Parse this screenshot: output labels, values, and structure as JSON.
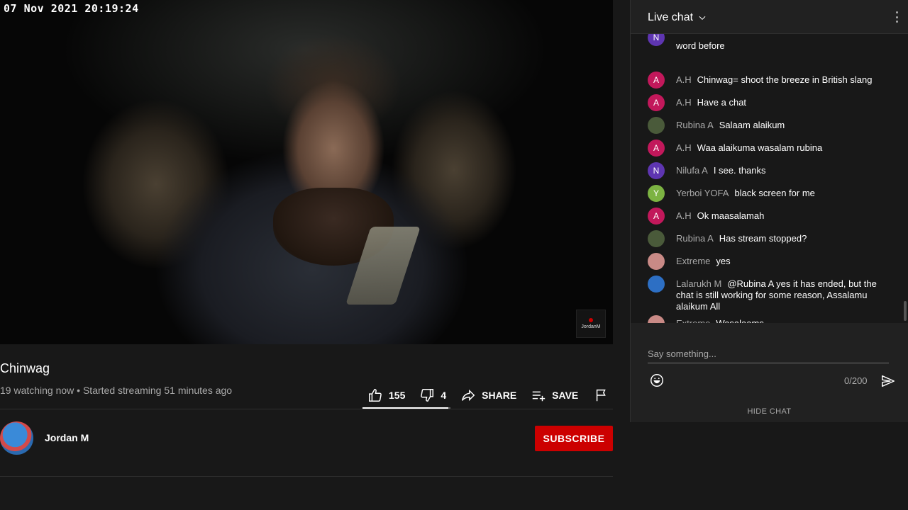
{
  "video": {
    "timestamp": "07 Nov 2021 20:19:24",
    "watermark": "JordanM"
  },
  "info": {
    "title": "Chinwag",
    "meta": "19 watching now • Started streaming 51 minutes ago"
  },
  "actions": {
    "like_count": "155",
    "dislike_count": "4",
    "share_label": "SHARE",
    "save_label": "SAVE",
    "like_ratio": 0.975
  },
  "channel": {
    "name": "Jordan M",
    "subscribe_label": "SUBSCRIBE"
  },
  "chat": {
    "header": "Live chat",
    "messages": [
      {
        "avatar_letter": "N",
        "avatar_color": "#5e35b1",
        "author": "",
        "text": "word before"
      },
      {
        "avatar_letter": "A",
        "avatar_color": "#c2185b",
        "author": "A.H",
        "text": "Chinwag= shoot the breeze in British slang"
      },
      {
        "avatar_letter": "A",
        "avatar_color": "#c2185b",
        "author": "A.H",
        "text": "Have a chat"
      },
      {
        "avatar_letter": "",
        "avatar_color": "#4a5a3a",
        "author": "Rubina A",
        "text": "Salaam alaikum"
      },
      {
        "avatar_letter": "A",
        "avatar_color": "#c2185b",
        "author": "A.H",
        "text": "Waa alaikuma wasalam rubina"
      },
      {
        "avatar_letter": "N",
        "avatar_color": "#5e35b1",
        "author": "Nilufa A",
        "text": "I see. thanks"
      },
      {
        "avatar_letter": "Y",
        "avatar_color": "#7cb342",
        "author": "Yerboi YOFA",
        "text": "black screen for me"
      },
      {
        "avatar_letter": "A",
        "avatar_color": "#c2185b",
        "author": "A.H",
        "text": "Ok maasalamah"
      },
      {
        "avatar_letter": "",
        "avatar_color": "#4a5a3a",
        "author": "Rubina A",
        "text": "Has stream stopped?"
      },
      {
        "avatar_letter": "",
        "avatar_color": "#c98a86",
        "author": "Extreme",
        "text": "yes"
      },
      {
        "avatar_letter": "",
        "avatar_color": "#2d6fc4",
        "author": "Lalarukh M",
        "text": "@Rubina A yes it has ended, but the chat is still working for some reason, Assalamu alaikum All"
      },
      {
        "avatar_letter": "",
        "avatar_color": "#c98a86",
        "author": "Extreme",
        "text": "Wasalaams"
      }
    ],
    "input_placeholder": "Say something...",
    "char_counter": "0/200",
    "hide_label": "HIDE CHAT"
  },
  "icons": {
    "like": "thumbs-up-icon",
    "dislike": "thumbs-down-icon",
    "share": "share-arrow-icon",
    "save": "playlist-add-icon",
    "report": "flag-icon",
    "emoji": "smiley-icon",
    "send": "send-arrow-icon",
    "more": "vertical-dots-icon",
    "dropdown": "chevron-down-icon"
  }
}
